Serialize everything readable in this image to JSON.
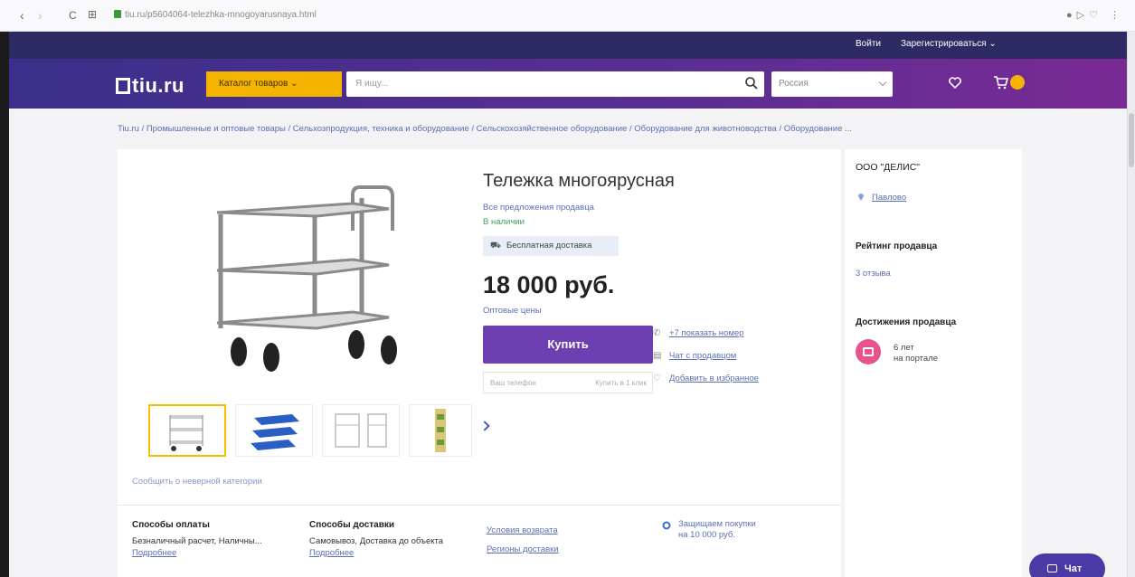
{
  "browser": {
    "url": "tiu.ru/p5604064-telezhka-mnogoyarusnaya.html",
    "nav_back": "‹",
    "nav_forward": "›",
    "nav_reload": "C",
    "nav_grid": "⊞",
    "right_icons": "●▷♡ ⋮"
  },
  "topbar": {
    "login": "Войти",
    "register": "Зарегистрироваться"
  },
  "header": {
    "logo": "tiu.ru",
    "catalog_label": "Каталог товаров",
    "search_placeholder": "Я ищу...",
    "region_value": "Россия"
  },
  "breadcrumb": "Tiu.ru / Промышленные и оптовые товары / Сельхозпродукция, техника и оборудование / Сельскохозяйственное оборудование / Оборудование для животноводства / Оборудование ...",
  "product": {
    "title": "Тележка многоярусная",
    "seller_offers": "Все предложения продавца",
    "availability": "В наличии",
    "delivery_badge": "Бесплатная доставка",
    "price": "18 000 руб.",
    "wholesale_link": "Оптовые цены",
    "buy_label": "Купить",
    "phone_placeholder": "Ваш телефон",
    "phone_request": "Купить в 1 клик",
    "actions": {
      "phone": "+7 показать номер",
      "chat": "Чат с продавцом",
      "favorite": "Добавить в избранное"
    },
    "report_link": "Сообщить о неверной категории"
  },
  "info": {
    "payment_heading": "Способы оплаты",
    "payment_text": "Безналичный расчет, Наличны...",
    "payment_more": "Подробнее",
    "delivery_heading": "Способы доставки",
    "delivery_text": "Самовывоз, Доставка до объекта",
    "delivery_more": "Подробнее",
    "return_link": "Условия возврата",
    "regions_link": "Регионы доставки",
    "guard_line1": "Защищаем покупки",
    "guard_line2": "на 10 000 руб."
  },
  "seller": {
    "name": "ООО \"ДЕЛИС\"",
    "city": "Павлово",
    "rating_heading": "Рейтинг продавца",
    "reviews": "3 отзыва",
    "achievements_heading": "Достижения продавца",
    "achievement_line1": "6 лет",
    "achievement_line2": "на портале"
  },
  "chat_button": "Чат",
  "colors": {
    "purple": "#6d3fb1",
    "yellow": "#f4b400",
    "link": "#5b6fb5"
  },
  "icons": [
    "search-icon",
    "heart-icon",
    "cart-icon",
    "truck-icon",
    "phone-icon",
    "chat-icon",
    "map-pin-icon",
    "shield-icon",
    "chevron-right-icon"
  ]
}
